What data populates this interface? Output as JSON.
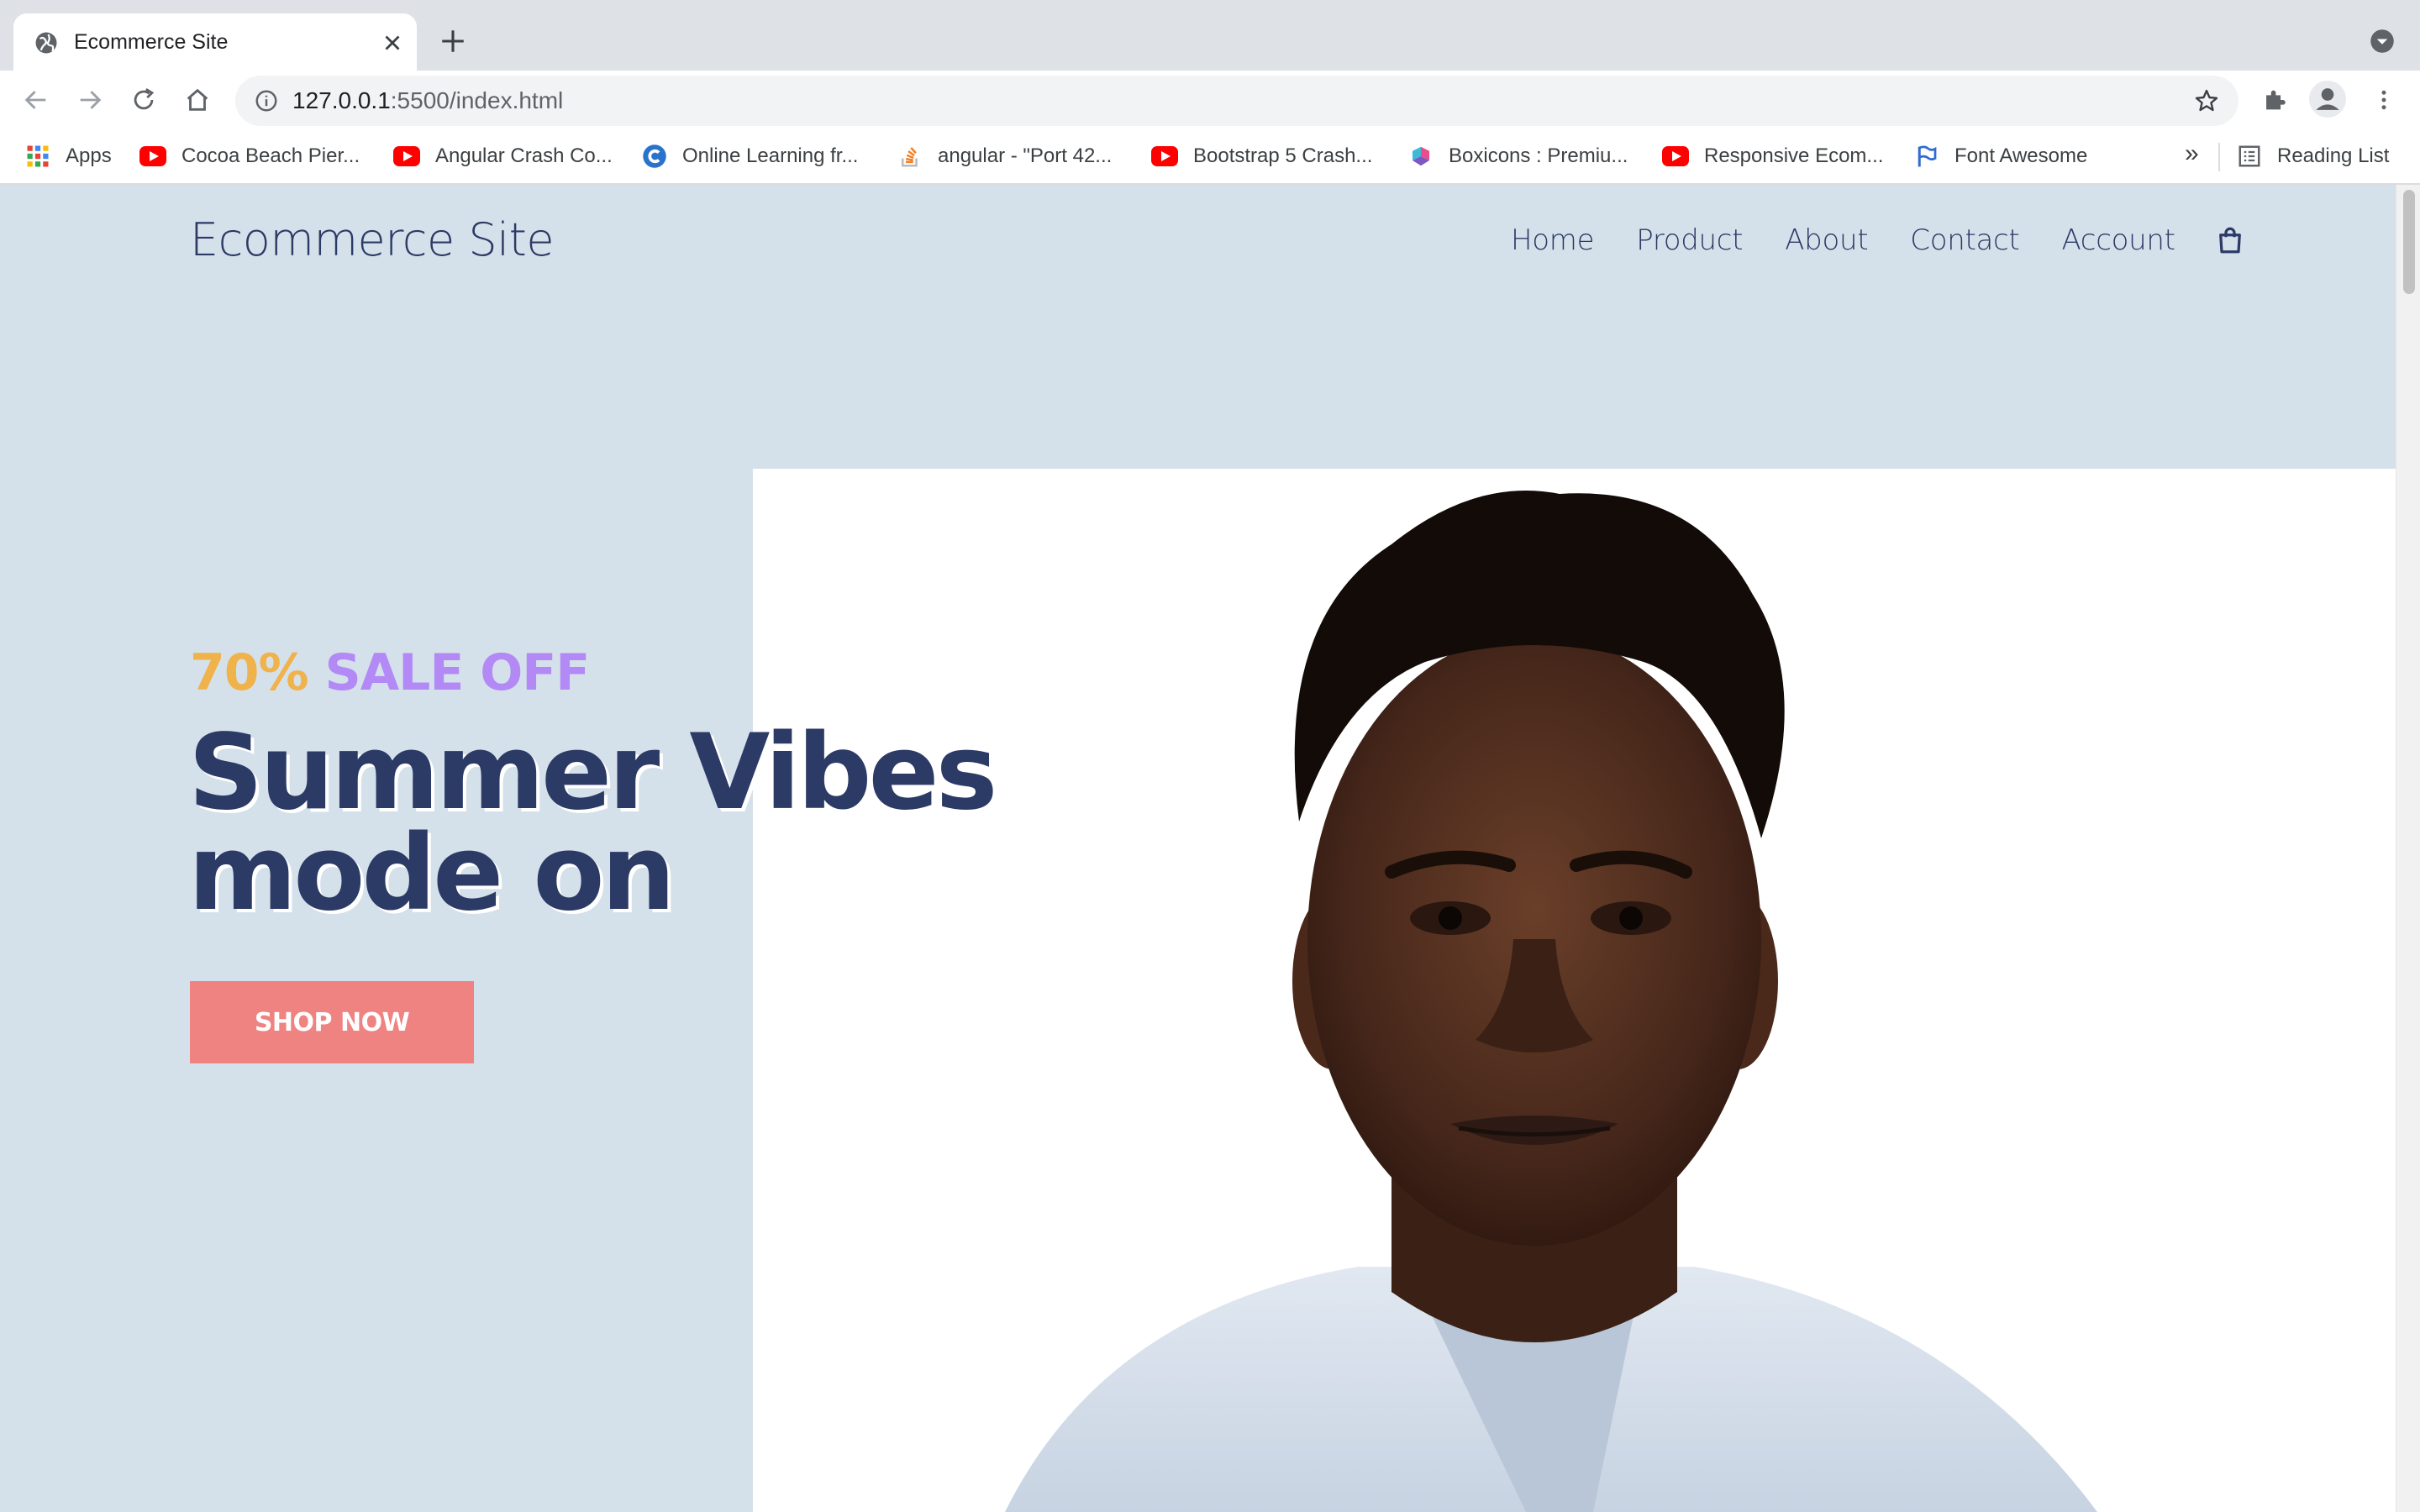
{
  "browser": {
    "tab": {
      "title": "Ecommerce Site",
      "favicon": "globe-icon"
    },
    "url": {
      "host": "127.0.0.1",
      "rest": ":5500/index.html"
    },
    "bookmarks": [
      {
        "label": "Apps",
        "icon": "apps-grid-icon"
      },
      {
        "label": "Cocoa Beach Pier...",
        "icon": "youtube-icon"
      },
      {
        "label": "Angular Crash Co...",
        "icon": "youtube-icon"
      },
      {
        "label": "Online Learning fr...",
        "icon": "coursera-icon"
      },
      {
        "label": "angular - \"Port 42...",
        "icon": "stackoverflow-icon"
      },
      {
        "label": "Bootstrap 5 Crash...",
        "icon": "youtube-icon"
      },
      {
        "label": "Boxicons : Premiu...",
        "icon": "boxicons-icon"
      },
      {
        "label": "Responsive Ecom...",
        "icon": "youtube-icon"
      },
      {
        "label": "Font Awesome",
        "icon": "flag-icon"
      }
    ],
    "bookmarks_more": "»",
    "reading_list": "Reading List"
  },
  "site": {
    "logo": "Ecommerce Site",
    "nav": [
      "Home",
      "Product",
      "About",
      "Contact",
      "Account"
    ],
    "hero": {
      "sale_percent": "70%",
      "sale_text": "SALE OFF",
      "heading_line1": "Summer Vibes",
      "heading_line2": "mode on",
      "cta": "SHOP NOW"
    }
  },
  "colors": {
    "page_bg": "#d5e1ea",
    "navy": "#2c3a66",
    "sale_orange": "#f0b24a",
    "sale_purple": "#b38af5",
    "cta": "#ef8382"
  }
}
